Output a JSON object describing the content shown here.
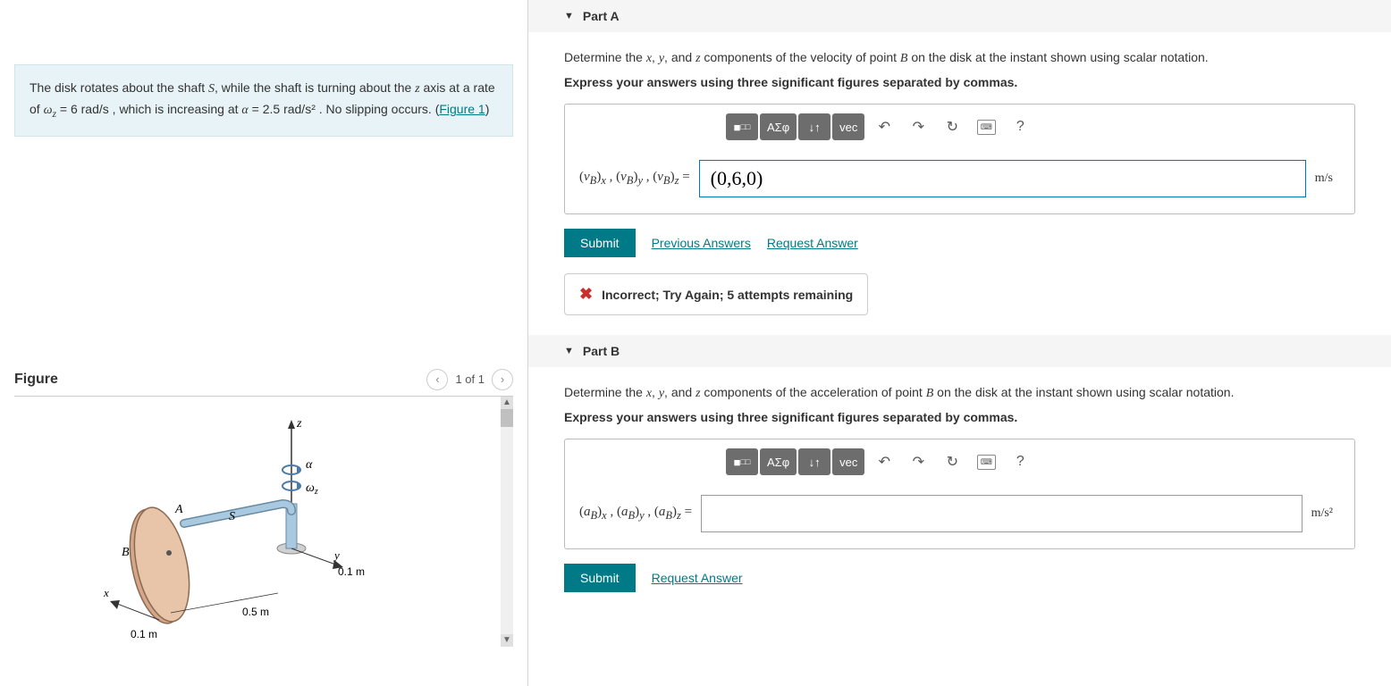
{
  "problem": {
    "text_before_S": "The disk rotates about the shaft ",
    "S": "S",
    "text_after_S": ", while the shaft is turning about the ",
    "z": "z",
    "text2": " axis at a rate of ",
    "omega_sym": "ω",
    "omega_sub": "z",
    "omega_eq": " = 6  rad/s ",
    "text3": ", which is increasing at ",
    "alpha_sym": "α",
    "alpha_eq": " = 2.5  rad/s²",
    "text4": " . No slipping occurs. (",
    "figure_link": "Figure 1",
    "text5": ")"
  },
  "figure": {
    "title": "Figure",
    "counter": "1 of 1",
    "labels": {
      "z": "z",
      "alpha": "α",
      "omega": "ω",
      "omega_sub": "z",
      "A": "A",
      "B": "B",
      "S": "S",
      "x": "x",
      "y": "y",
      "d1": "0.1 m",
      "d2": "0.5 m",
      "d3": "0.1 m"
    }
  },
  "partA": {
    "header": "Part A",
    "prompt_pre": "Determine the ",
    "x": "x",
    "y": "y",
    "zvar": "z",
    "prompt_mid": " components of the velocity of point ",
    "B": "B",
    "prompt_post": " on the disk at the instant shown using scalar notation.",
    "instruction": "Express your answers using three significant figures separated by commas.",
    "var_label": "(v_B)_x , (v_B)_y , (v_B)_z =",
    "input_value": "(0,6,0)",
    "unit": "m/s",
    "submit": "Submit",
    "prev_answers": "Previous Answers",
    "request": "Request Answer",
    "feedback": "Incorrect; Try Again; 5 attempts remaining"
  },
  "partB": {
    "header": "Part B",
    "prompt_pre": "Determine the ",
    "x": "x",
    "y": "y",
    "zvar": "z",
    "prompt_mid": " components of the acceleration of point ",
    "B": "B",
    "prompt_post": " on the disk at the instant shown using scalar notation.",
    "instruction": "Express your answers using three significant figures separated by commas.",
    "var_label": "(a_B)_x , (a_B)_y , (a_B)_z =",
    "input_value": "",
    "unit": "m/s²",
    "submit": "Submit",
    "request": "Request Answer"
  },
  "tools": {
    "template": "■",
    "frac": "√",
    "greek": "ΑΣφ",
    "sub": "↓↑",
    "vec": "vec",
    "undo": "↶",
    "redo": "↷",
    "reset": "↻",
    "help": "?"
  }
}
